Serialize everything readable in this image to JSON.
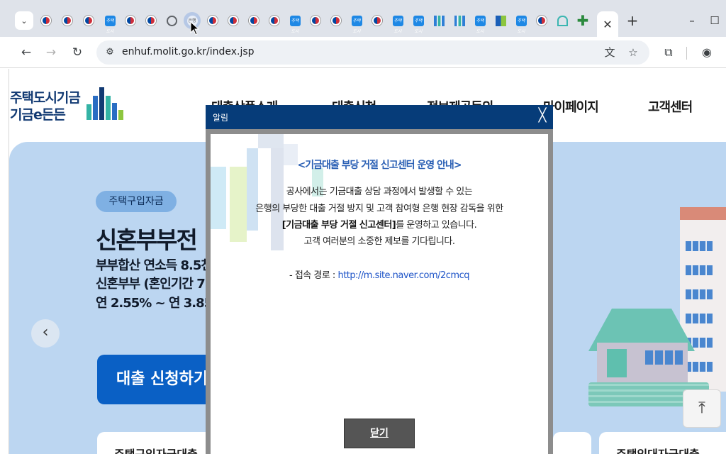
{
  "browser": {
    "tabs_button_icon": "chevron-down-icon",
    "active_tab_favicon_text": "은행",
    "favicon_blue_text": "주택도시",
    "close_tab_icon": "✕",
    "new_tab_icon": "+",
    "minimize_icon": "–",
    "maximize_icon": "☐",
    "url": "enhuf.molit.go.kr/index.jsp",
    "back_icon": "←",
    "forward_icon": "→",
    "reload_icon": "↻",
    "site_info_icon": "⚙",
    "translate_icon": "文",
    "star_icon": "☆",
    "extensions_icon": "⧉",
    "profile_icon": "◉"
  },
  "site": {
    "logo_line1": "주택도시기금",
    "logo_line2": "기금e든든",
    "nav": [
      "대출상품소개",
      "대출신청",
      "정보제공동의",
      "마이페이지",
      "고객센터"
    ],
    "colors": {
      "navy": "#063c79",
      "hero": "#bcd6f1",
      "button": "#0a60c5"
    }
  },
  "hero": {
    "badge": "주택구입자금",
    "title": "신혼부부전",
    "line1": "부부합산 연소득 8.5천",
    "line2": "신혼부부 (혼인기간 7년",
    "line3": "연 2.55% ~ 연 3.85%",
    "prev_icon": "‹",
    "apply_button": "대출 신청하기",
    "card_left": "주택구입자금대출",
    "card_right": "주택임대자금대출",
    "top_button_icon": "⤒"
  },
  "modal": {
    "header": "알림",
    "close_icon": "╳",
    "title": "<기금대출 부당 거절 신고센터 운영 안내>",
    "line1": "공사에서는 기금대출 상담 과정에서 발생할 수 있는",
    "line2": "은행의 부당한 대출 거절 방지 및 고객 참여형 은행 현장 감독을 위한",
    "line3_bold": "[기금대출 부당 거절 신고센터]",
    "line3_rest": "를 운영하고 있습니다.",
    "line4": "고객 여러분의 소중한 제보를 기다립니다.",
    "route_label": "- 접속 경로 : ",
    "route_link": "http://m.site.naver.com/2cmcq",
    "close_button": "닫기"
  }
}
